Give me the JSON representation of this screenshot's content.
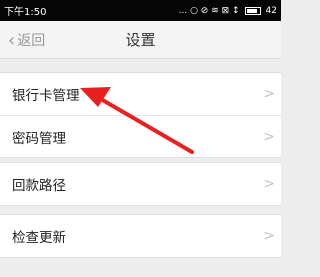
{
  "status_bar": {
    "time": "下午1:50",
    "indicators": "... ○ ⊘ ≋ ⊠ ↕",
    "battery": "42"
  },
  "nav": {
    "back_label": "返回",
    "back_icon": "chevron-left-icon",
    "title": "设置"
  },
  "groups": [
    {
      "items": [
        {
          "label": "银行卡管理"
        },
        {
          "label": "密码管理"
        }
      ]
    },
    {
      "items": [
        {
          "label": "回款路径"
        }
      ]
    },
    {
      "items": [
        {
          "label": "检查更新"
        }
      ]
    }
  ],
  "chevron_glyph": ">",
  "colors": {
    "annotation_arrow": "#e82020",
    "background": "#ededed",
    "status_bar": "#050505"
  }
}
